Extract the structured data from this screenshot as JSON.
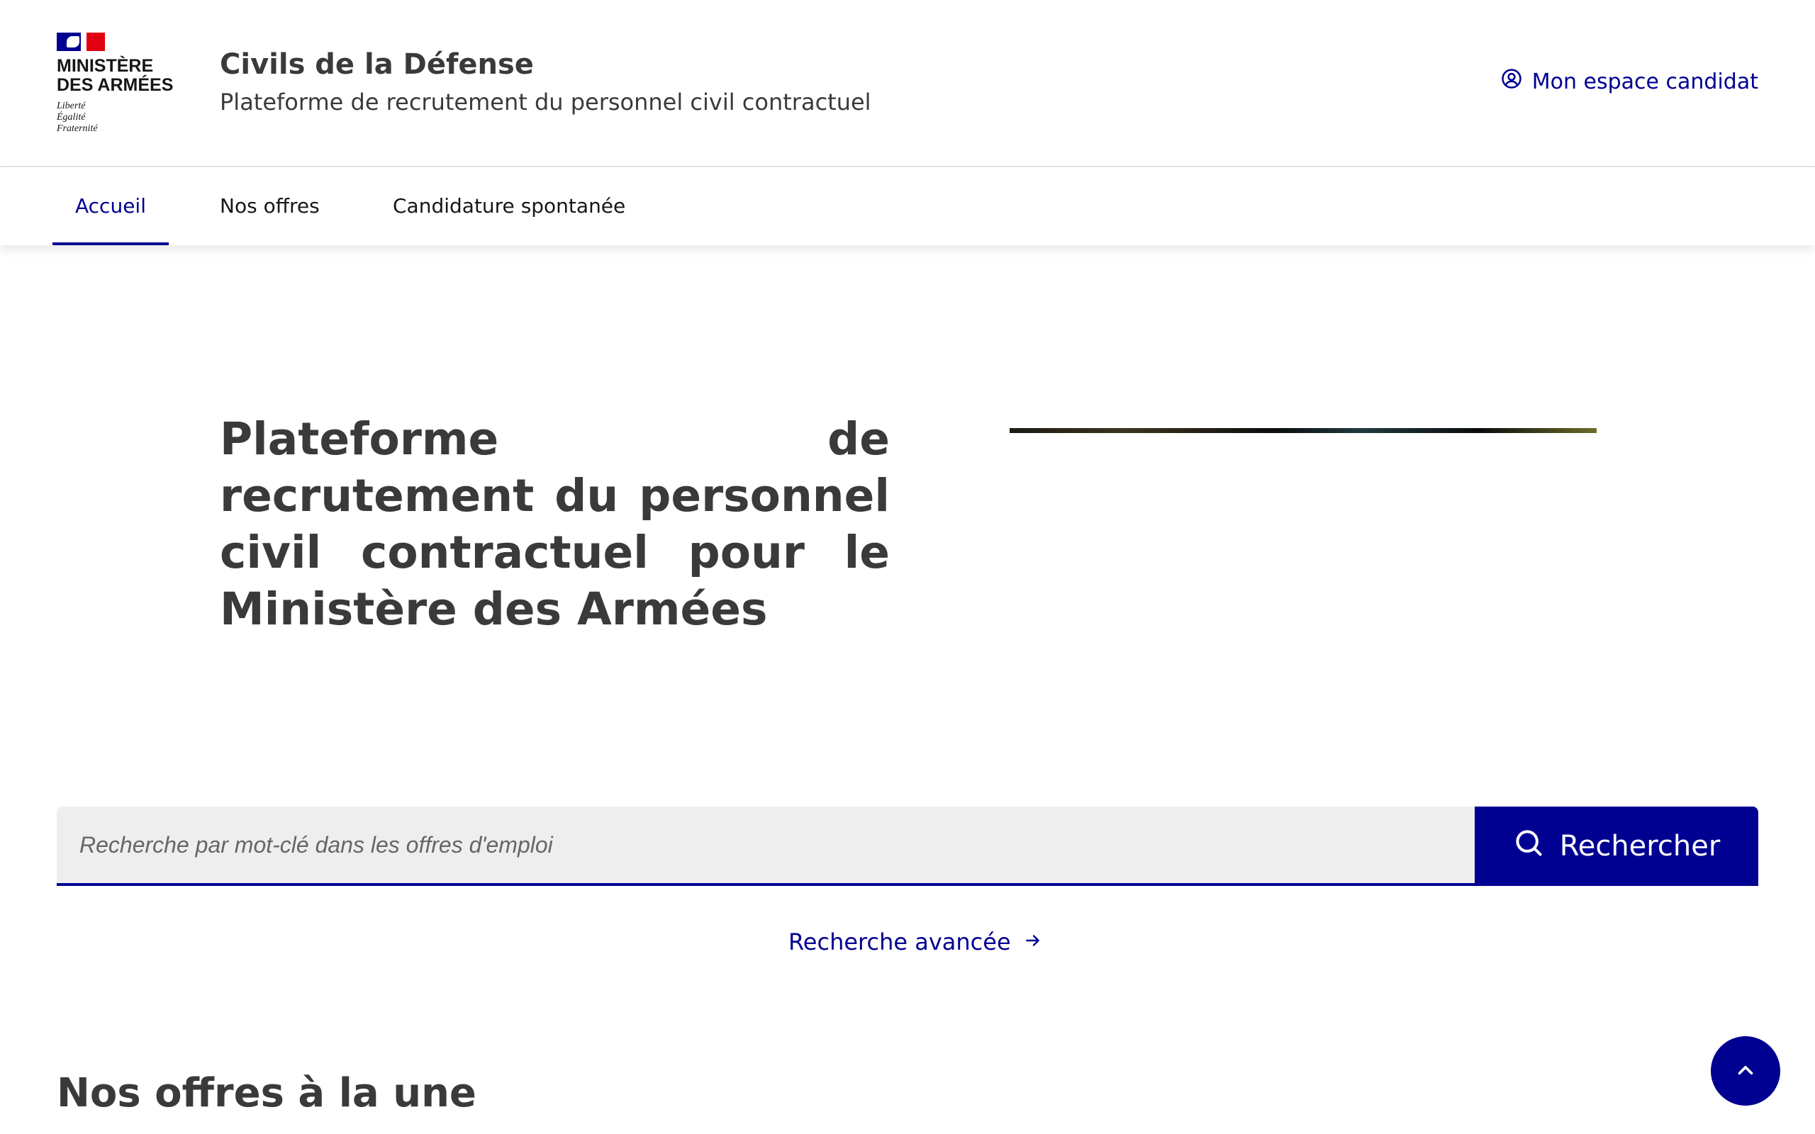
{
  "header": {
    "ministry_line1": "MINISTÈRE",
    "ministry_line2": "DES ARMÉES",
    "motto_line1": "Liberté",
    "motto_line2": "Égalité",
    "motto_line3": "Fraternité",
    "site_title": "Civils de la Défense",
    "site_tagline": "Plateforme de recrutement du personnel civil contractuel",
    "account_label": "Mon espace candidat",
    "account_icon": "user-circle-icon"
  },
  "nav": {
    "items": [
      {
        "label": "Accueil",
        "active": true
      },
      {
        "label": "Nos offres",
        "active": false
      },
      {
        "label": "Candidature spontanée",
        "active": false
      }
    ]
  },
  "hero": {
    "title_line1": "Plateforme de recrutement",
    "title_line2": "du personnel civil contractuel",
    "title_line3": "pour le Ministère des Armées"
  },
  "search": {
    "placeholder": "Recherche par mot-clé dans les offres d'emploi",
    "button_label": "Rechercher",
    "button_icon": "search-icon",
    "advanced_label": "Recherche avancée",
    "advanced_icon": "arrow-right-icon"
  },
  "featured": {
    "heading": "Nos offres à la une"
  },
  "back_to_top": {
    "icon": "chevron-up-icon"
  },
  "colors": {
    "primary": "#000091",
    "flag_blue": "#000091",
    "flag_red": "#e1000f",
    "heading_text": "#3a3a3a",
    "input_background": "#eeeeee"
  }
}
